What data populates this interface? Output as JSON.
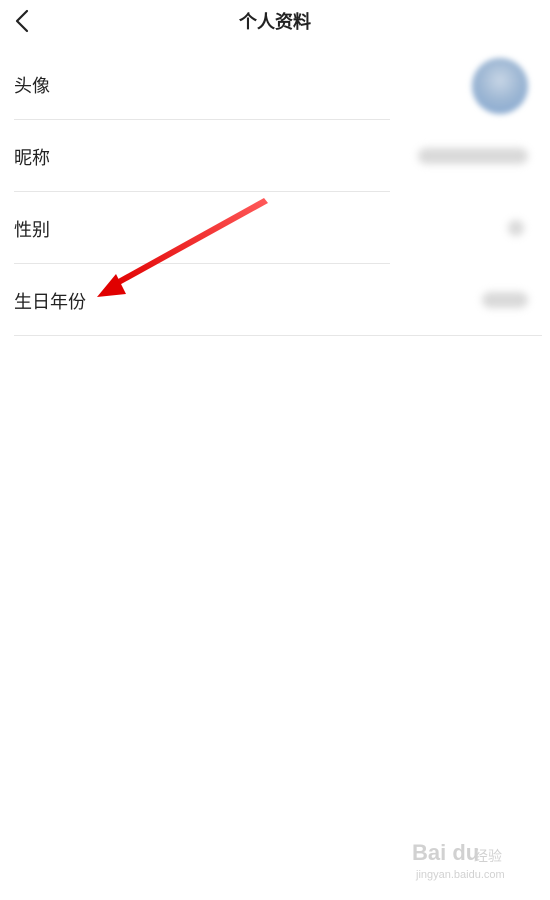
{
  "header": {
    "title": "个人资料",
    "back_icon": "chevron-left-icon"
  },
  "profile": {
    "rows": [
      {
        "label": "头像",
        "value_type": "avatar-image-blurred"
      },
      {
        "label": "昵称",
        "value_type": "blurred-text"
      },
      {
        "label": "性别",
        "value_type": "blurred-text"
      },
      {
        "label": "生日年份",
        "value_type": "blurred-text"
      }
    ]
  },
  "annotation": {
    "type": "red-arrow",
    "color": "#e01010",
    "points_to": "生日年份"
  },
  "watermark": {
    "brand": "Bai du",
    "sub": "经验",
    "url": "jingyan.baidu.com"
  },
  "colors": {
    "background": "#ffffff",
    "text": "#222222",
    "divider": "#e6e6e6"
  }
}
